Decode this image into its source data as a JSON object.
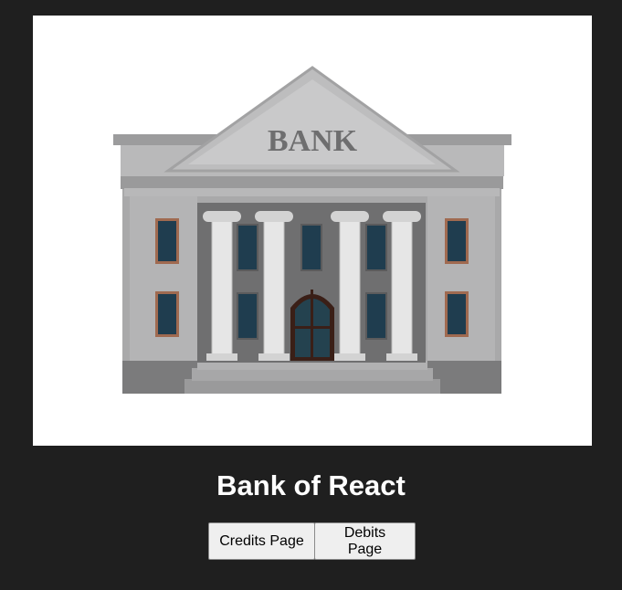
{
  "hero": {
    "image_label": "BANK",
    "colors": {
      "background": "#ffffff",
      "stone": "#a9a9aa",
      "stone_dark": "#8c8c8d",
      "window": "#1f3d4f",
      "door": "#3a1f17"
    }
  },
  "page": {
    "title": "Bank of React",
    "background": "#1f1f1f"
  },
  "nav": {
    "credits_label": "Credits Page",
    "debits_label": "Debits Page"
  }
}
